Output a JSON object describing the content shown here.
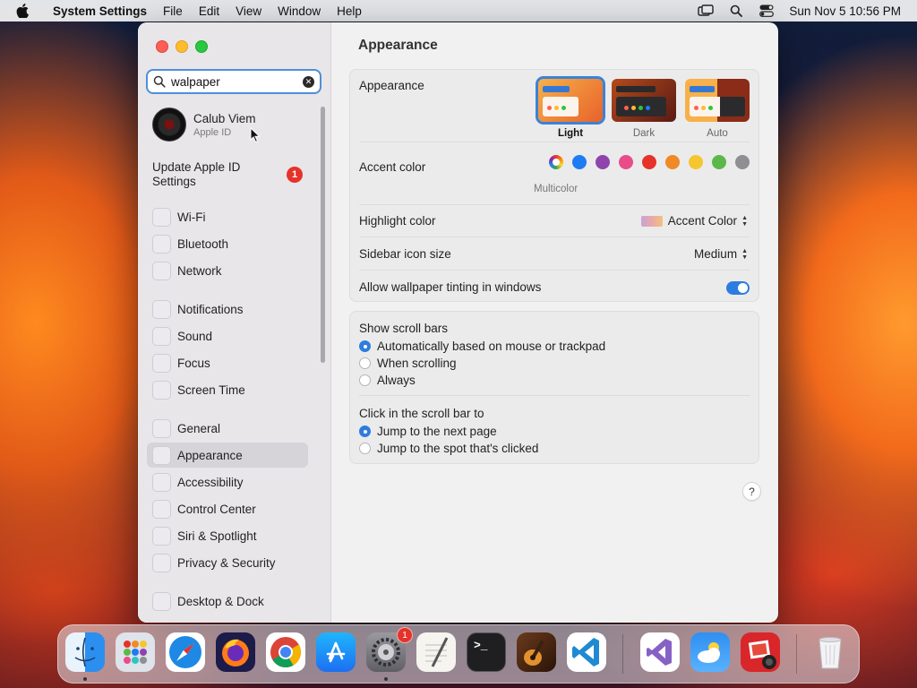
{
  "menubar": {
    "app_name": "System Settings",
    "items": [
      "File",
      "Edit",
      "View",
      "Window",
      "Help"
    ],
    "clock": "Sun Nov 5  10:56 PM"
  },
  "sidebar": {
    "search": {
      "value": "walpaper",
      "placeholder": "Search"
    },
    "account": {
      "name": "Calub Viem",
      "subtitle": "Apple ID"
    },
    "update": {
      "label": "Update Apple ID Settings",
      "badge": "1"
    },
    "items": [
      {
        "label": "Wi-Fi"
      },
      {
        "label": "Bluetooth"
      },
      {
        "label": "Network"
      },
      {
        "label": "Notifications"
      },
      {
        "label": "Sound"
      },
      {
        "label": "Focus"
      },
      {
        "label": "Screen Time"
      },
      {
        "label": "General"
      },
      {
        "label": "Appearance"
      },
      {
        "label": "Accessibility"
      },
      {
        "label": "Control Center"
      },
      {
        "label": "Siri & Spotlight"
      },
      {
        "label": "Privacy & Security"
      },
      {
        "label": "Desktop & Dock"
      }
    ],
    "selected": "Appearance"
  },
  "content": {
    "title": "Appearance",
    "appearance": {
      "label": "Appearance",
      "options": [
        "Light",
        "Dark",
        "Auto"
      ],
      "selected": "Light"
    },
    "accent": {
      "label": "Accent color",
      "colors": [
        "multicolor",
        "#1f7bf2",
        "#8e44ad",
        "#ea4c89",
        "#e5332a",
        "#f08a24",
        "#f6c631",
        "#5cb849",
        "#8e8e93"
      ],
      "caption": "Multicolor"
    },
    "highlight": {
      "label": "Highlight color",
      "value": "Accent Color"
    },
    "icon_size": {
      "label": "Sidebar icon size",
      "value": "Medium"
    },
    "tinting": {
      "label": "Allow wallpaper tinting in windows",
      "enabled": true
    },
    "scroll_bars": {
      "label": "Show scroll bars",
      "options": [
        "Automatically based on mouse or trackpad",
        "When scrolling",
        "Always"
      ],
      "selected": "Automatically based on mouse or trackpad"
    },
    "click_scroll": {
      "label": "Click in the scroll bar to",
      "options": [
        "Jump to the next page",
        "Jump to the spot that's clicked"
      ],
      "selected": "Jump to the next page"
    },
    "help": "?"
  },
  "dock": {
    "apps": [
      "finder",
      "launchpad",
      "safari",
      "firefox",
      "chrome",
      "app-store",
      "system-settings",
      "textedit",
      "terminal",
      "garageband",
      "vscode",
      "visual-studio",
      "weather",
      "photo-booth",
      "trash"
    ],
    "settings_badge": "1"
  },
  "colors": {
    "accent": "#2f7ce0",
    "badge": "#e5332a"
  }
}
